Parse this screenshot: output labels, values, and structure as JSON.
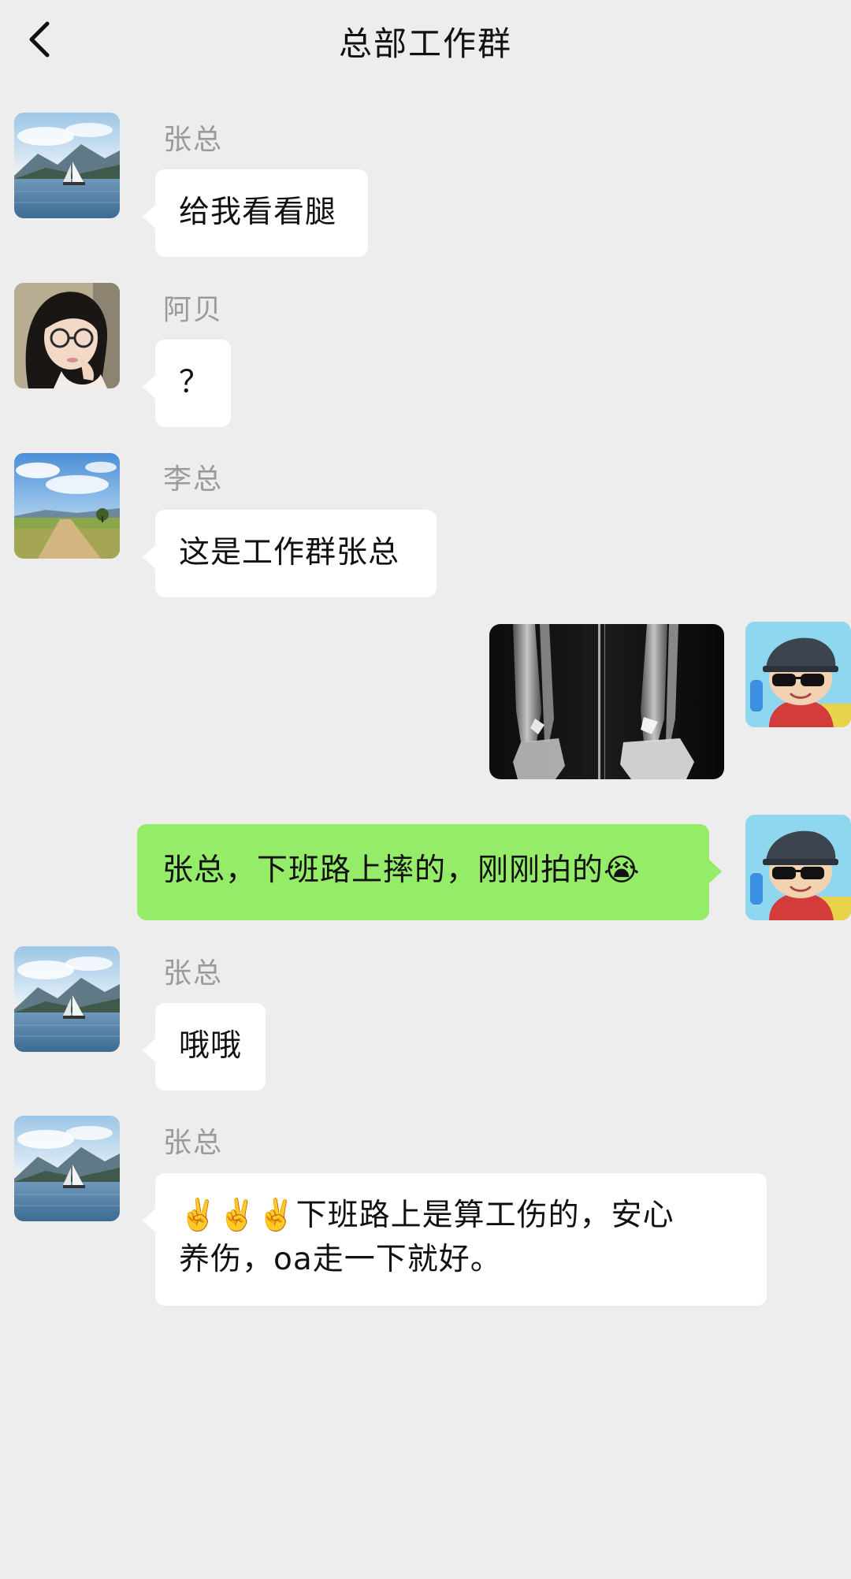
{
  "header": {
    "title": "总部工作群",
    "back_icon": "chevron-left-icon"
  },
  "messages": [
    {
      "sender": "张总",
      "text": "给我看看腿",
      "side": "left",
      "avatar": "sailboat-lake-avatar"
    },
    {
      "sender": "阿贝",
      "text": "？",
      "side": "left",
      "avatar": "girl-glasses-avatar"
    },
    {
      "sender": "李总",
      "text": "这是工作群张总",
      "side": "left",
      "avatar": "country-road-avatar"
    },
    {
      "sender": "",
      "image": "leg-xray-photo",
      "side": "right",
      "avatar": "cartoon-boy-sunglasses-avatar"
    },
    {
      "sender": "",
      "text": "张总，下班路上摔的，刚刚拍的😭",
      "side": "right",
      "avatar": "cartoon-boy-sunglasses-avatar"
    },
    {
      "sender": "张总",
      "text": "哦哦",
      "side": "left",
      "avatar": "sailboat-lake-avatar"
    },
    {
      "sender": "张总",
      "text": "✌️✌️✌️下班路上是算工伤的，安心\n养伤，oa走一下就好。",
      "side": "left",
      "avatar": "sailboat-lake-avatar"
    }
  ],
  "colors": {
    "background": "#ededed",
    "incoming_bubble": "#ffffff",
    "outgoing_bubble": "#95ec69",
    "sender_name": "#9a9a9a"
  }
}
